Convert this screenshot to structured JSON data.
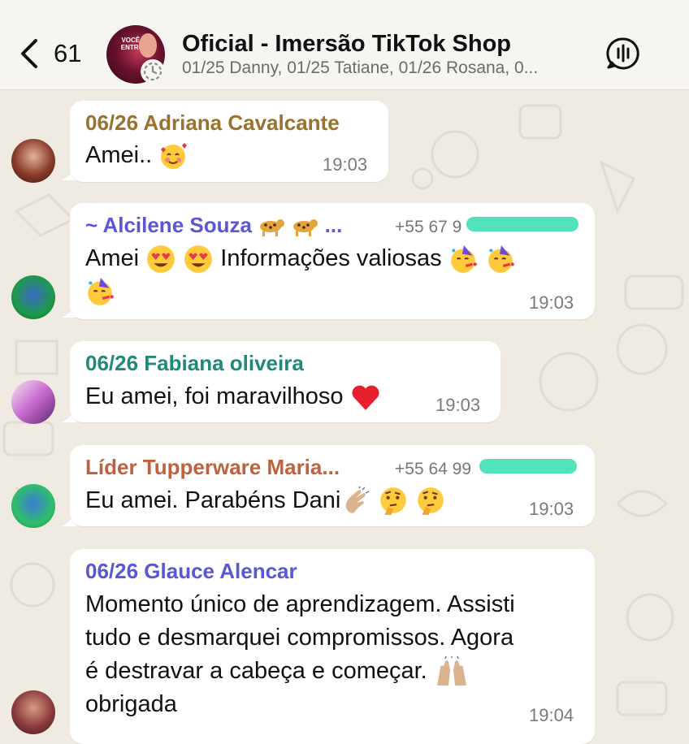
{
  "header": {
    "back_count": "61",
    "group_title": "Oficial - Imersão TikTok Shop",
    "group_subtitle": "01/25 Danny, 01/25 Tatiane, 01/26 Rosana, 0...",
    "avatar_text": "VOCÊ JÁ ENTROU!"
  },
  "messages": [
    {
      "sender": "06/26 Adriana Cavalcante",
      "sender_color": "#9a7230",
      "text": "Amei..",
      "time": "19:03"
    },
    {
      "sender": "~ Alcilene Souza",
      "sender_suffix": "...",
      "sender_color": "#5a56d4",
      "phone": "+55 67 9",
      "text": "Amei",
      "text2": "Informações valiosas",
      "time": "19:03"
    },
    {
      "sender": "06/26 Fabiana oliveira",
      "sender_color": "#1f8a78",
      "text": "Eu amei, foi maravilhoso",
      "time": "19:03"
    },
    {
      "sender": "Líder Tupperware Maria...",
      "sender_color": "#c0603f",
      "phone": "+55 64 99",
      "text": "Eu amei. Parabéns Dani",
      "time": "19:03"
    },
    {
      "sender": "06/26 Glauce Alencar",
      "sender_color": "#5a56d4",
      "lines": [
        "Momento único de aprendizagem. Assisti",
        "tudo e desmarquei compromissos. Agora",
        "é destravar a cabeça e começar.",
        "obrigada"
      ],
      "time": "19:04"
    }
  ],
  "icons": [
    "back-chevron-icon",
    "status-ring-icon",
    "audio-call-icon",
    "smiling-hearts-emoji",
    "heart-eyes-emoji",
    "partying-face-emoji",
    "red-heart-emoji",
    "clapping-hands-emoji",
    "thinking-face-emoji",
    "raising-hands-emoji",
    "leopard-emoji"
  ]
}
